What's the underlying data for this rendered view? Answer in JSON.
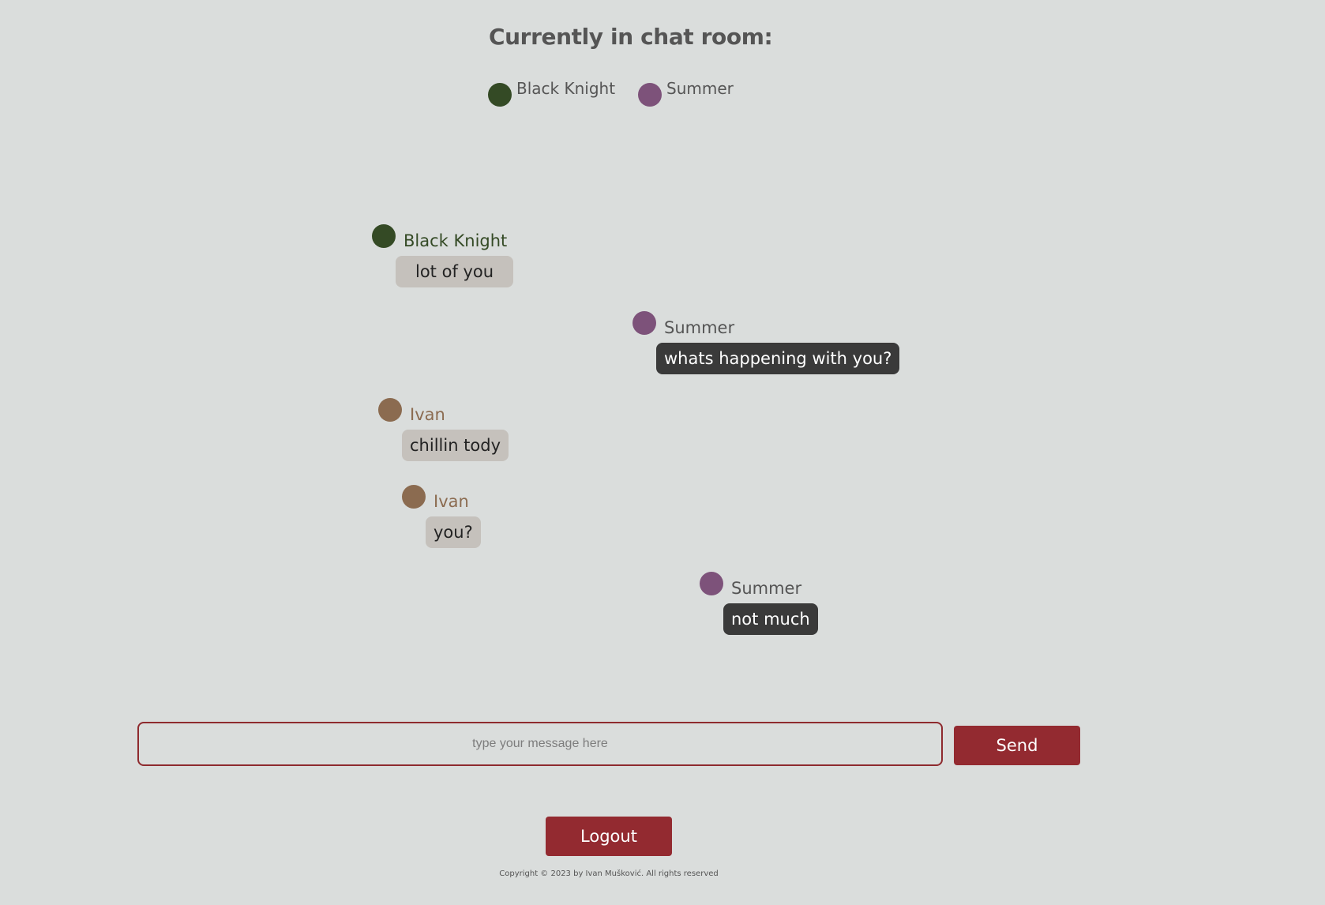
{
  "header": {
    "title": "Currently in chat room:"
  },
  "online_users": [
    {
      "name": "Black Knight",
      "color": "#344a25"
    },
    {
      "name": "Summer",
      "color": "#7d527a"
    }
  ],
  "messages": [
    {
      "sender": "Black Knight",
      "text": "lot of you",
      "color": "#344a25",
      "own": false
    },
    {
      "sender": "Summer",
      "text": "whats happening with you?",
      "color": "#7d527a",
      "own": true
    },
    {
      "sender": "Ivan",
      "text": "chillin tody",
      "color": "#8b6b50",
      "own": false
    },
    {
      "sender": "Ivan",
      "text": "you?",
      "color": "#8b6b50",
      "own": false
    },
    {
      "sender": "Summer",
      "text": "not much",
      "color": "#7d527a",
      "own": true
    }
  ],
  "composer": {
    "placeholder": "type your message here",
    "value": "",
    "send_label": "Send"
  },
  "logout_label": "Logout",
  "footer": {
    "copyright": "Copyright © 2023 by Ivan Mušković. All rights reserved"
  },
  "theme": {
    "background": "#dadddc",
    "accent": "#932a30",
    "their_bubble": "#c5c1bc",
    "own_bubble": "#3a3a3a"
  }
}
